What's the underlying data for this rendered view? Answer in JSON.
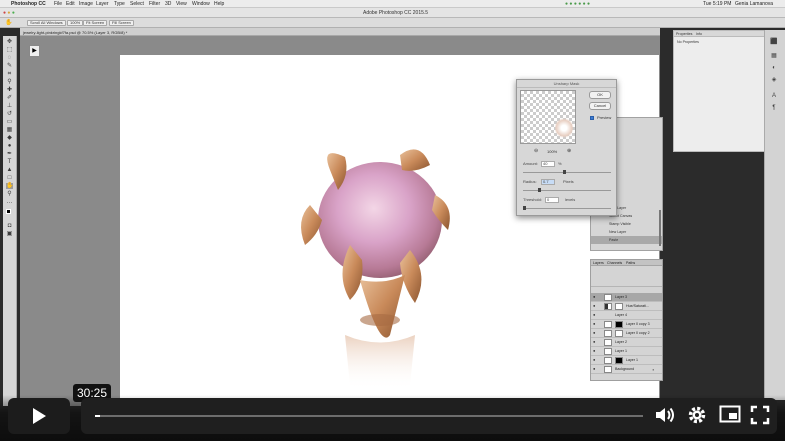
{
  "menubar": {
    "app": "Photoshop CC",
    "menus": [
      "File",
      "Edit",
      "Image",
      "Layer",
      "Type",
      "Select",
      "Filter",
      "3D",
      "View",
      "Window",
      "Help"
    ],
    "clock": "Tue 5:19 PM",
    "user": "Genia Lamanova"
  },
  "window": {
    "title": "Adobe Photoshop CC 2015.5"
  },
  "options_bar": {
    "buttons": [
      "Scroll All Windows",
      "100%",
      "Fit Screen",
      "Fill Screen"
    ]
  },
  "document_tab": {
    "label": "jewelry-light-pinkringkf7fa.psd @ 70.5% (Layer 3, RGB/8) *"
  },
  "unsharp_mask": {
    "title": "Unsharp Mask",
    "ok_label": "OK",
    "cancel_label": "Cancel",
    "preview_label": "Preview",
    "zoom_value": "100%",
    "amount_label": "Amount:",
    "amount_value": "40",
    "amount_unit": "%",
    "radius_label": "Radius:",
    "radius_value": "0.7",
    "radius_unit": "Pixels",
    "threshold_label": "Threshold:",
    "threshold_value": "0",
    "threshold_unit": "levels"
  },
  "history": {
    "items": [
      "New Layer",
      "Select Canvas",
      "Stamp Visible",
      "New Layer",
      "Paste"
    ]
  },
  "properties": {
    "tabs": [
      "Properties",
      "Info"
    ],
    "empty_text": "No Properties"
  },
  "layers": {
    "tabs": [
      "Layers",
      "Channels",
      "Paths"
    ],
    "rows": [
      {
        "name": "Layer 3"
      },
      {
        "name": "Hue/Saturati..."
      },
      {
        "name": "Layer 4"
      },
      {
        "name": "Layer 0 copy 3"
      },
      {
        "name": "Layer 0 copy 2"
      },
      {
        "name": "Layer 2"
      },
      {
        "name": "Layer 1"
      },
      {
        "name": "Layer 1"
      },
      {
        "name": "Background"
      }
    ]
  },
  "player": {
    "time_tooltip": "30:25",
    "progress": 0.01
  },
  "colors": {
    "workspace": "#8a8a8a",
    "canvas": "#ffffff",
    "player_bar": "#1f1f1f",
    "gem_pink": "#d9a3c8",
    "gold": "#c98a5a"
  },
  "icons": [
    "play-icon",
    "volume-icon",
    "settings-icon",
    "pip-icon",
    "fullscreen-icon"
  ]
}
